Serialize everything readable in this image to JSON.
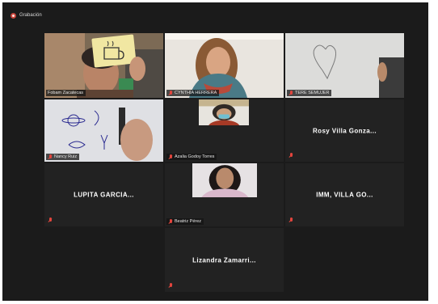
{
  "recording": {
    "label": "Grabación"
  },
  "colors": {
    "active_speaker": "#b7d33a",
    "muted_icon": "#e2453d",
    "tile_bg": "#222222"
  },
  "participants": [
    {
      "name": "Fobam Zacatecas",
      "video": true,
      "muted": true,
      "active": true
    },
    {
      "name": "CYNTHIA HERRERA",
      "video": true,
      "muted": true
    },
    {
      "name": "TERE SEMUJER",
      "video": true,
      "muted": true
    },
    {
      "name": "Nancy Ruiz",
      "video": true,
      "muted": true
    },
    {
      "name": "Azalia Godoy Torres",
      "video": true,
      "muted": true
    },
    {
      "name": "Rosy Villa Gonza...",
      "video": false,
      "muted": true
    },
    {
      "name": "LUPITA GARCIA...",
      "video": false,
      "muted": true
    },
    {
      "name": "Beatriz Pérez",
      "video": true,
      "muted": true
    },
    {
      "name": "IMM, VILLA GO...",
      "video": false,
      "muted": true
    },
    {
      "name": "Lizandra Zamarri...",
      "video": false,
      "muted": true
    }
  ]
}
